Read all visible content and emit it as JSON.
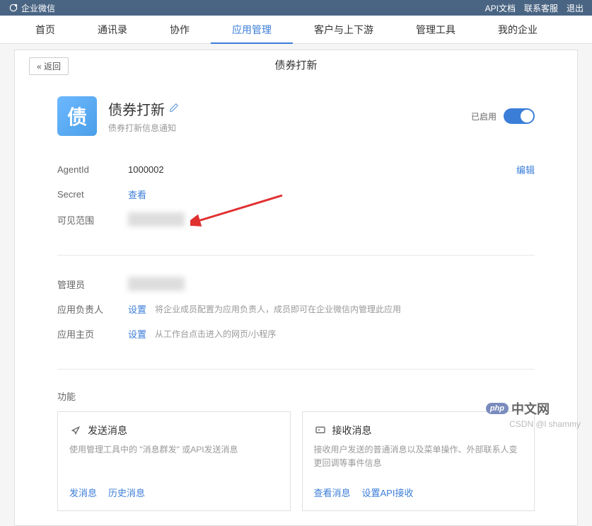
{
  "topbar": {
    "brand": "企业微信",
    "links": {
      "api_doc": "API文档",
      "contact": "联系客服",
      "logout": "退出"
    }
  },
  "nav": {
    "items": [
      "首页",
      "通讯录",
      "协作",
      "应用管理",
      "客户与上下游",
      "管理工具",
      "我的企业"
    ],
    "active_index": 3
  },
  "back": {
    "label": "« 返回"
  },
  "page_title": "债券打新",
  "app": {
    "icon_text": "债",
    "name": "债券打新",
    "desc": "债券打新信息通知",
    "enabled_label": "已启用"
  },
  "info": {
    "agentid_label": "AgentId",
    "agentid_value": "1000002",
    "edit_label": "编辑",
    "secret_label": "Secret",
    "secret_view": "查看",
    "scope_label": "可见范围",
    "admin_label": "管理员",
    "owner_label": "应用负责人",
    "owner_set": "设置",
    "owner_hint": "将企业成员配置为应用负责人，成员即可在企业微信内管理此应用",
    "home_label": "应用主页",
    "home_set": "设置",
    "home_hint": "从工作台点击进入的网页/小程序"
  },
  "functions": {
    "heading": "功能",
    "send": {
      "title": "发送消息",
      "desc": "使用管理工具中的 \"消息群发\" 或API发送消息",
      "actions": [
        "发消息",
        "历史消息"
      ]
    },
    "receive": {
      "title": "接收消息",
      "desc": "接收用户发送的普通消息以及菜单操作、外部联系人变更回调等事件信息",
      "actions": [
        "查看消息",
        "设置API接收"
      ]
    }
  },
  "watermark": {
    "csdn": "CSDN @l shammy",
    "phpcn": "中文网"
  }
}
